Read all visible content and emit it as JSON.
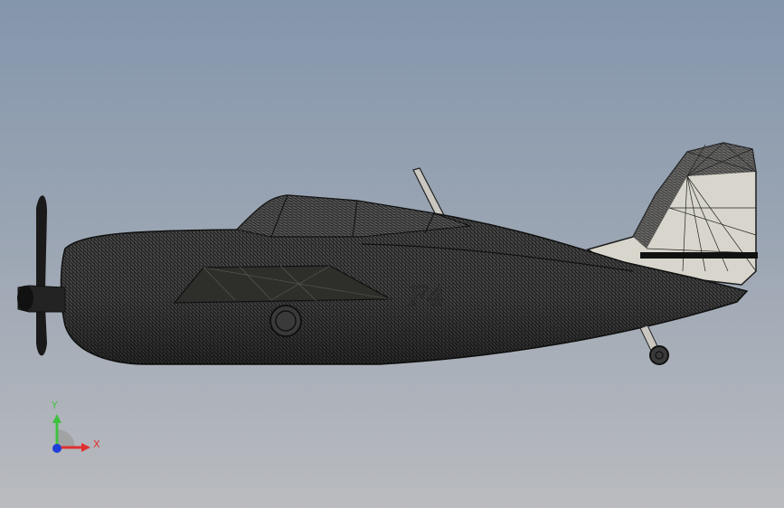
{
  "viewport": {
    "background_top": "#8496ac",
    "background_bottom": "#b9bbbf"
  },
  "model": {
    "fuselage_marking": "F4",
    "mesh_color": "#1c1c1c",
    "tail_fill": "#d8d6cc"
  },
  "triad": {
    "y_label": "Y",
    "x_label": "X",
    "y_color": "#3fc13f",
    "x_color": "#e03030",
    "z_color": "#1f3fd8"
  }
}
